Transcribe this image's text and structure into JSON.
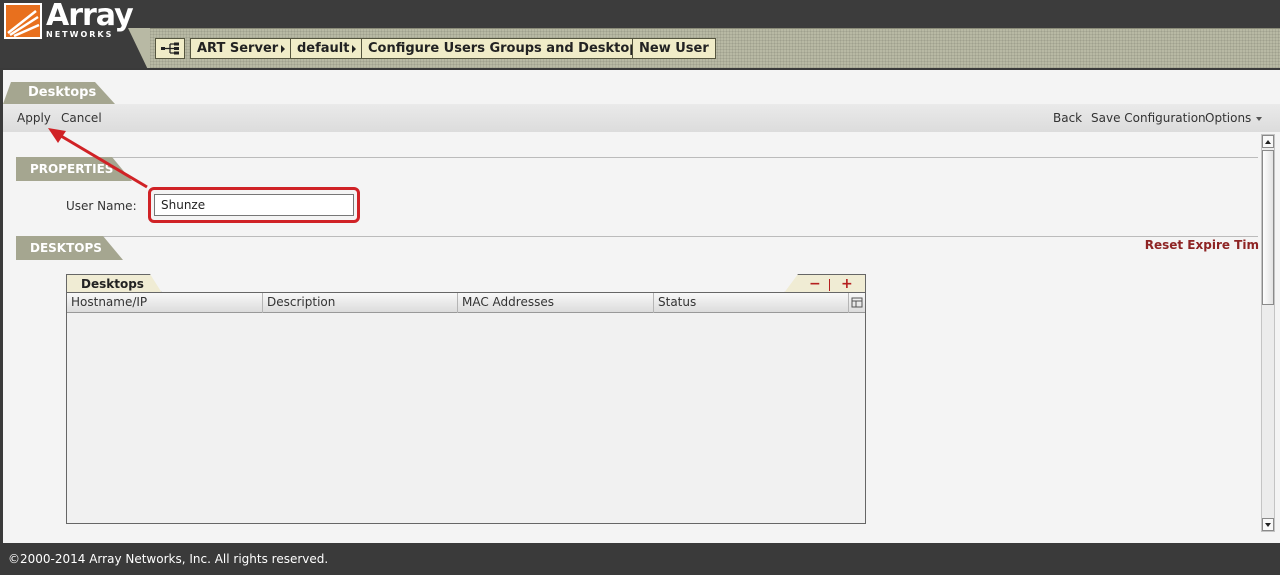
{
  "brand": {
    "name": "Array",
    "tagline": "NETWORKS",
    "orange": "#e8701e"
  },
  "breadcrumbs": [
    {
      "label": "ART Server",
      "has_arrow": true
    },
    {
      "label": "default",
      "has_arrow": true
    },
    {
      "label": "Configure Users Groups and Desktops",
      "has_arrow": true
    },
    {
      "label": "New User",
      "has_arrow": false
    }
  ],
  "page": {
    "tab_title": "Desktops"
  },
  "toolbar": {
    "apply": "Apply",
    "cancel": "Cancel",
    "back": "Back",
    "save": "Save Configuration",
    "options": "Options"
  },
  "properties": {
    "section_title": "PROPERTIES",
    "username_label": "User Name:",
    "username_value": "Shunze"
  },
  "desktops": {
    "section_title": "DESKTOPS",
    "reset_link": "Reset Expire Tim",
    "grid_title": "Desktops",
    "add_label": "+",
    "remove_label": "−",
    "columns": [
      "Hostname/IP",
      "Description",
      "MAC Addresses",
      "Status"
    ],
    "rows": []
  },
  "footer": {
    "copyright": "©2000-2014 Array Networks, Inc. All rights reserved."
  },
  "colors": {
    "section_tab": "#a5a690",
    "highlight": "#d02226",
    "link": "#8e2424"
  }
}
